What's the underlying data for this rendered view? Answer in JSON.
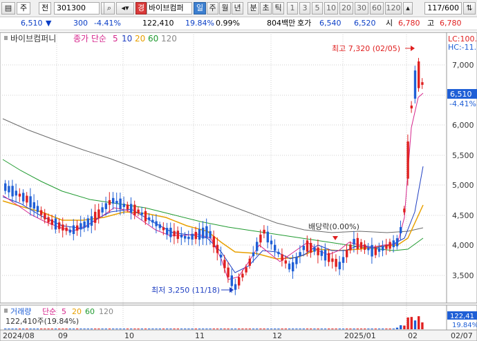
{
  "toolbar": {
    "market_type": "주",
    "market_type2": "전",
    "code": "301300",
    "stock_name": "바이브컴퍼",
    "stock_badge": "경",
    "periods": [
      "일",
      "주",
      "월",
      "년",
      "분",
      "초",
      "틱"
    ],
    "active_period": "일",
    "intervals": [
      "1",
      "3",
      "5",
      "10",
      "20",
      "30",
      "60",
      "120"
    ],
    "count": "117/600"
  },
  "quote": {
    "price": "6,510",
    "change": "300",
    "change_pct": "-4.41%",
    "volume": "122,410",
    "vol_ratio": "19.84%",
    "turnover_pct": "0.99%",
    "value": "804백만",
    "ask_label": "호가",
    "ask1": "6,540",
    "ask2": "6,520",
    "open_label": "시",
    "open": "6,780",
    "high_label": "고",
    "high": "6,780"
  },
  "price_panel": {
    "legend_name": "바이브컴퍼니",
    "legend_ma": "종가 단순",
    "ma_periods": [
      "5",
      "10",
      "20",
      "60",
      "120"
    ],
    "lc_label": "LC:100.",
    "hc_label": "HC:-11.",
    "price_tag": "6,510",
    "pct_tag": "-4.41%",
    "high_note": "최고 7,320 (02/05)",
    "low_note": "최저 3,250 (11/18)",
    "div_note": "배당락(0.00%)"
  },
  "volume_panel": {
    "legend_name": "거래량",
    "legend_ma": "단순",
    "ma_periods": [
      "5",
      "20",
      "60",
      "120"
    ],
    "value_line": "122,410주(19.84%)",
    "tag": "122,41",
    "tag_pct": "19.84%"
  },
  "colors": {
    "up": "#e02020",
    "down": "#1f5fd6",
    "ma5": "#d6268c",
    "ma10": "#1f3fc2",
    "ma20": "#e8a000",
    "ma60": "#1f9a2f",
    "ma120": "#6a6a6a"
  },
  "chart_data": {
    "type": "candlestick",
    "y_ticks": [
      "7,000",
      "6,500",
      "6,000",
      "5,500",
      "5,000",
      "4,500",
      "4,000",
      "3,500"
    ],
    "y_range": [
      3100,
      7400
    ],
    "x_labels": [
      "2024/08",
      "09",
      "10",
      "11",
      "12",
      "2025/01",
      "02",
      "02/07"
    ],
    "high": {
      "value": 7320,
      "date": "02/05"
    },
    "low": {
      "value": 3250,
      "date": "11/18"
    },
    "last": {
      "close": 6510,
      "change": -300,
      "change_pct": -4.41,
      "volume": 122410
    }
  }
}
